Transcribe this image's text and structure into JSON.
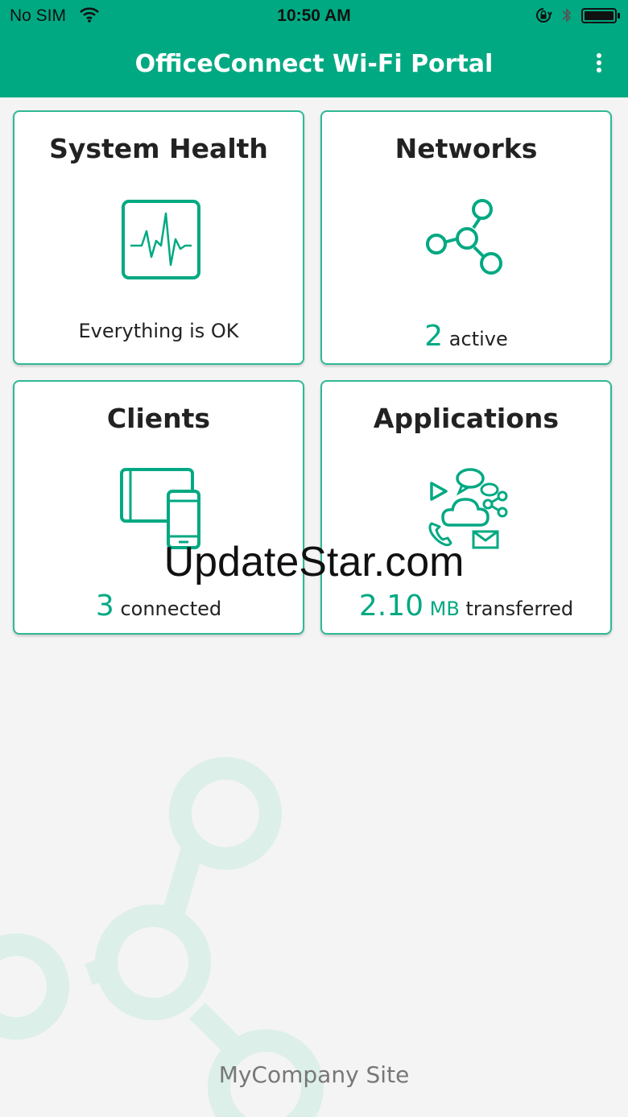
{
  "status_bar": {
    "carrier": "No SIM",
    "time": "10:50 AM",
    "icons": [
      "wifi-icon",
      "orientation-lock-icon",
      "bluetooth-icon",
      "battery-icon"
    ]
  },
  "header": {
    "title": "OfficeConnect Wi-Fi Portal",
    "menu_icon": "more-vertical-icon"
  },
  "tiles": {
    "system_health": {
      "title": "System Health",
      "icon": "heartbeat-monitor-icon",
      "status_text": "Everything is OK"
    },
    "networks": {
      "title": "Networks",
      "icon": "network-nodes-icon",
      "count": "2",
      "suffix": "active"
    },
    "clients": {
      "title": "Clients",
      "icon": "devices-icon",
      "count": "3",
      "suffix": "connected"
    },
    "applications": {
      "title": "Applications",
      "icon": "cloud-apps-icon",
      "amount": "2.10",
      "unit": "MB",
      "suffix": "transferred"
    }
  },
  "watermark": "UpdateStar.com",
  "site_name": "MyCompany Site",
  "colors": {
    "brand": "#01a982",
    "ok": "#5fa91a",
    "background": "#f4f4f4"
  }
}
